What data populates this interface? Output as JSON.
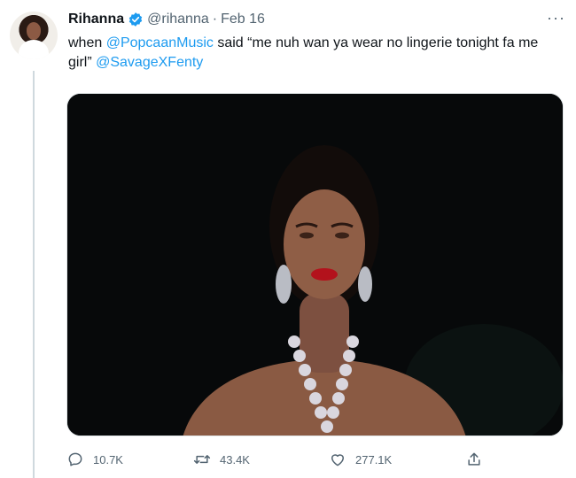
{
  "tweet": {
    "author_name": "Rihanna",
    "handle": "@rihanna",
    "separator": "·",
    "date": "Feb 16",
    "text_prefix": "when ",
    "mention_1": "@PopcaanMusic",
    "text_mid": " said “me nuh wan ya wear no lingerie tonight fa me girl” ",
    "mention_2": "@SavageXFenty",
    "more_label": "···"
  },
  "actions": {
    "replies": "10.7K",
    "retweets": "43.4K",
    "likes": "277.1K"
  },
  "icons": {
    "verified": "verified-badge-icon",
    "reply": "reply-icon",
    "retweet": "retweet-icon",
    "like": "heart-icon",
    "share": "share-icon",
    "more": "more-icon"
  },
  "colors": {
    "link": "#1d9bf0",
    "secondary_text": "#536471",
    "media_background": "#07090a"
  }
}
